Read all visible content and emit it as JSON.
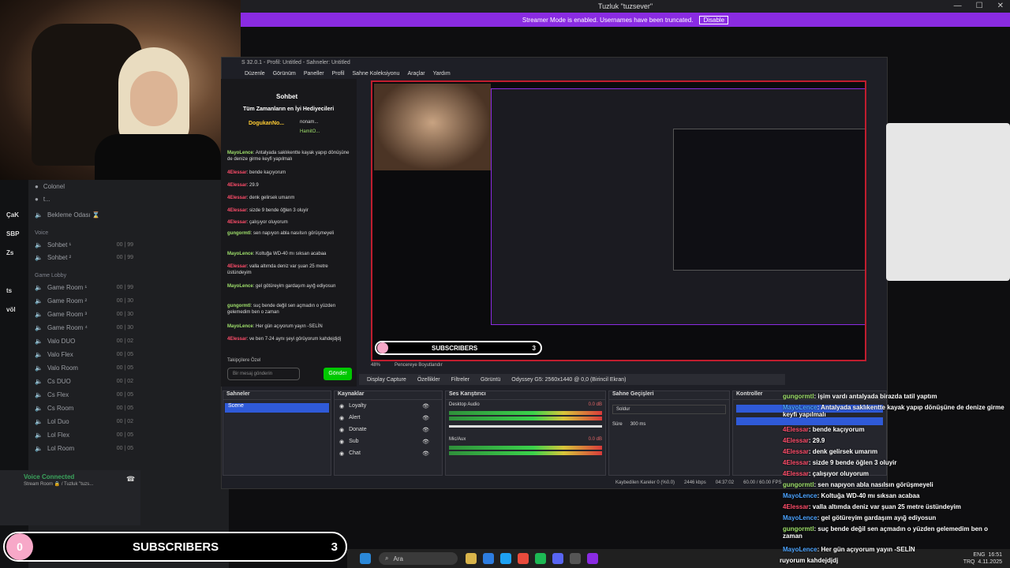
{
  "window": {
    "title": "Tuzluk \"tuzsever\"",
    "streamer_mode": "Streamer Mode is enabled. Usernames have been truncated.",
    "disable": "Disable"
  },
  "discord": {
    "servers": [
      "ÇaK",
      "SBP",
      "Zs",
      "ts",
      "völ"
    ],
    "top_users": [
      "Colonel",
      "t..."
    ],
    "waiting_room": "Bekleme Odası ⌛",
    "cat_voice": "Voice",
    "channels_voice": [
      {
        "label": "Sohbet ¹",
        "count": "00 | 99"
      },
      {
        "label": "Sohbet ²",
        "count": "00 | 99"
      }
    ],
    "cat_game": "Game Lobby",
    "channels_game": [
      {
        "label": "Game Room ¹",
        "count": "00 | 99"
      },
      {
        "label": "Game Room ²",
        "count": "00 | 30"
      },
      {
        "label": "Game Room ³",
        "count": "00 | 30"
      },
      {
        "label": "Game Room ⁴",
        "count": "00 | 30"
      },
      {
        "label": "Valo DUO",
        "count": "00 | 02"
      },
      {
        "label": "Valo Flex",
        "count": "00 | 05"
      },
      {
        "label": "Valo Room",
        "count": "00 | 05"
      },
      {
        "label": "Cs DUO",
        "count": "00 | 02"
      },
      {
        "label": "Cs Flex",
        "count": "00 | 05"
      },
      {
        "label": "Cs Room",
        "count": "00 | 05"
      },
      {
        "label": "Lol Duo",
        "count": "00 | 02"
      },
      {
        "label": "Lol Flex",
        "count": "00 | 05"
      },
      {
        "label": "Lol Room",
        "count": "00 | 05"
      }
    ],
    "voice_connected": "Voice Connected",
    "voice_sub": "Stream Room 🔒 / Tuzluk \"tuzs..."
  },
  "obs": {
    "title": "S 32.0.1 - Profil: Untitled - Sahneler: Untitled",
    "menu": [
      "Düzenle",
      "Görünüm",
      "Paneller",
      "Profil",
      "Sahne Koleksiyonu",
      "Araçlar",
      "Yardım"
    ],
    "chat_header": "Sohbet",
    "chat_title": "Tüm Zamanların en İyi Hediyecileri",
    "gifters": [
      "DogukanNo...",
      "nonam...",
      "HamitO..."
    ],
    "chat_placeholder": "Bir mesaj gönderin",
    "send": "Gönder",
    "followers_only": "Takipçilere Özel",
    "source_bar": [
      "Display Capture",
      "Özellikler",
      "Filtreler",
      "Görüntü",
      "Odyssey G5: 2560x1440 @ 0,0 (Birincil Ekran)"
    ],
    "zoom": "48%",
    "fit": "Pencereye Boyutlandır",
    "docks": {
      "scenes": "Sahneler",
      "scene_item": "Scene",
      "sources": "Kaynaklar",
      "source_items": [
        "Loyalty",
        "Alert",
        "Donate",
        "Sub",
        "Chat"
      ],
      "mixer": "Ses Karıştırıcı",
      "desktop_audio": "Desktop Audio",
      "mic_aux": "Mic/Aux",
      "db": "0.0 dB",
      "transitions": "Sahne Geçişleri",
      "fade": "Soldur",
      "duration_label": "Süre",
      "duration": "300 ms",
      "controls": "Kontroller"
    },
    "status": [
      "Kaybedilen Kareler 0 (%0.0)",
      "2446 kbps",
      "04:37:02",
      "60.00 / 60.00 FPS"
    ]
  },
  "preview_sub": {
    "label": "SUBSCRIBERS",
    "count": "3"
  },
  "chat_messages": [
    {
      "user": "MayoLence",
      "text": ": Antalyada saklıkentte kayak yapıp dönüşüne de denize girme keyfi yapılmalı",
      "color": "green"
    },
    {
      "user": "4Elessar",
      "text": ": bende kaçıyorum",
      "color": "red"
    },
    {
      "user": "4Elessar",
      "text": ": 29.9",
      "color": "red"
    },
    {
      "user": "4Elessar",
      "text": ": denk gelirsek umarım",
      "color": "red"
    },
    {
      "user": "4Elessar",
      "text": ": sizde 9 bende öğlen 3 oluyir",
      "color": "red"
    },
    {
      "user": "4Elessar",
      "text": ": çalışıyor oluyorum",
      "color": "red"
    },
    {
      "user": "gungormtl",
      "text": ": sen napıyon abla nasılsın görüşmeyeli",
      "color": "green"
    },
    {
      "user": "MayoLence",
      "text": ": Koltuğa WD-40 mı sıksan acabaa",
      "color": "green"
    },
    {
      "user": "4Elessar",
      "text": ": valla altımda deniz var şuan 25 metre üstündeyim",
      "color": "red"
    },
    {
      "user": "MayoLence",
      "text": ": gel götüreyim gardaşım ayığ ediyosun",
      "color": "green"
    },
    {
      "user": "gungormtl",
      "text": ": suç bende değil sen açmadın o yüzden gelemedim ben o zaman",
      "color": "green"
    },
    {
      "user": "MayoLence",
      "text": ": Her gün açıyorum yayın -SELİN",
      "color": "green"
    },
    {
      "user": "4Elessar",
      "text": ": ve ben 7-24 aynı şeyi görüyorum kahdejdjdj",
      "color": "red"
    }
  ],
  "overlay_chat": [
    {
      "user": "gungormtl",
      "text": ": işim vardı antalyada birazda tatil yaptım"
    },
    {
      "user": "MayoLence",
      "text": ": Antalyada saklıkentte kayak yapıp dönüşüne de denize girme keyfi yapılmalı"
    },
    {
      "user": "4Elessar",
      "text": ": bende kaçıyorum"
    },
    {
      "user": "4Elessar",
      "text": ": 29.9"
    },
    {
      "user": "4Elessar",
      "text": ": denk gelirsek umarım"
    },
    {
      "user": "4Elessar",
      "text": ": sizde 9 bende öğlen 3 oluyir"
    },
    {
      "user": "4Elessar",
      "text": ": çalışıyor oluyorum"
    },
    {
      "user": "gungormtl",
      "text": ": sen napıyon abla nasılsın görüşmeyeli"
    },
    {
      "user": "MayoLence",
      "text": ": Koltuğa WD-40 mı sıksan acabaa"
    },
    {
      "user": "4Elessar",
      "text": ": valla altımda deniz var şuan 25 metre üstündeyim"
    },
    {
      "user": "MayoLence",
      "text": ": gel götüreyim gardaşım ayığ ediyosun"
    },
    {
      "user": "gungormtl",
      "text": ": suç bende değil sen açmadın o yüzden gelemedim ben o zaman"
    },
    {
      "user": "MayoLence",
      "text": ": Her gün açıyorum yayın -SELİN"
    },
    {
      "user": "",
      "text": "ruyorum kahdejdjdj"
    }
  ],
  "subscribers": {
    "circle": "0",
    "label": "SUBSCRIBERS",
    "count": "3"
  },
  "taskbar": {
    "search": "Ara",
    "lang": "ENG",
    "lang2": "TRQ",
    "time": "16:51",
    "date": "4.11.2025"
  }
}
